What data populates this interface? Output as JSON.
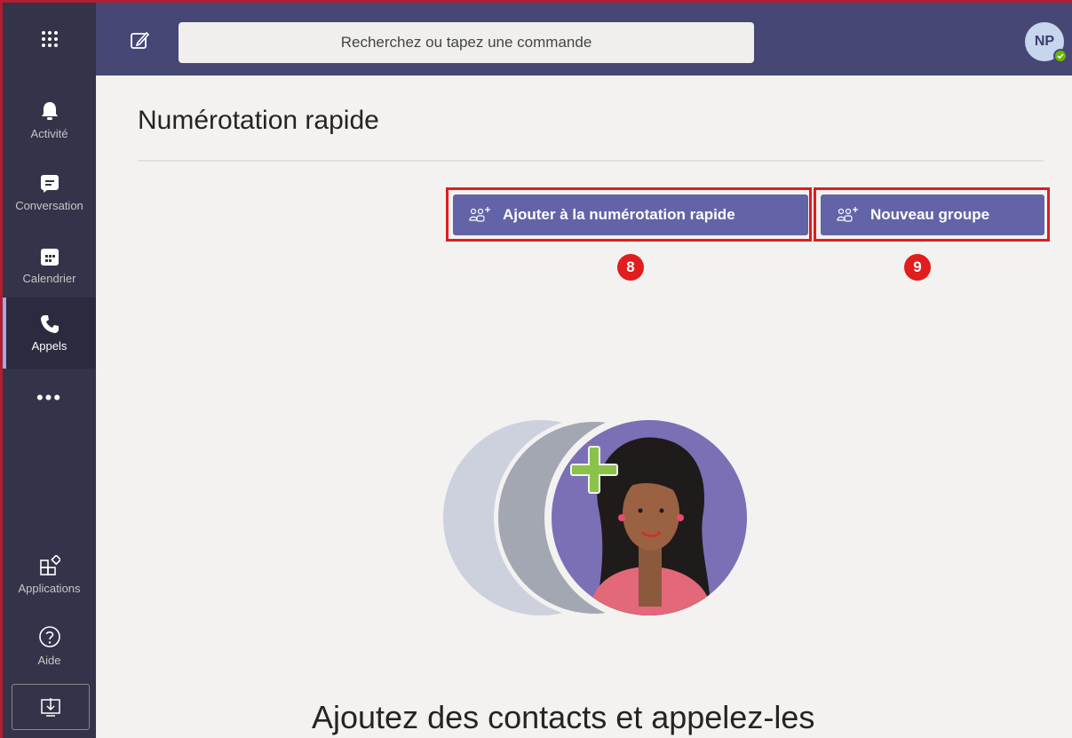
{
  "search": {
    "placeholder": "Recherchez ou tapez une commande"
  },
  "user": {
    "initials": "NP",
    "presence_color": "#6bb700"
  },
  "rail": {
    "items": [
      {
        "label": "Activité",
        "icon": "bell-icon"
      },
      {
        "label": "Conversation",
        "icon": "chat-icon"
      },
      {
        "label": "Calendrier",
        "icon": "calendar-icon"
      },
      {
        "label": "Appels",
        "icon": "phone-icon",
        "active": true
      },
      {
        "label": "Applications",
        "icon": "apps-icon"
      },
      {
        "label": "Aide",
        "icon": "help-icon"
      }
    ],
    "more": "•••"
  },
  "page": {
    "title": "Numérotation rapide",
    "buttons": {
      "add_speed_dial": "Ajouter à la numérotation rapide",
      "new_group": "Nouveau groupe"
    },
    "callouts": [
      "8",
      "9"
    ],
    "empty_heading": "Ajoutez des contacts et appelez-les"
  },
  "colors": {
    "brand": "#6264a7",
    "topbar": "#464775",
    "rail": "#33344a",
    "callout": "#e11d1d"
  }
}
